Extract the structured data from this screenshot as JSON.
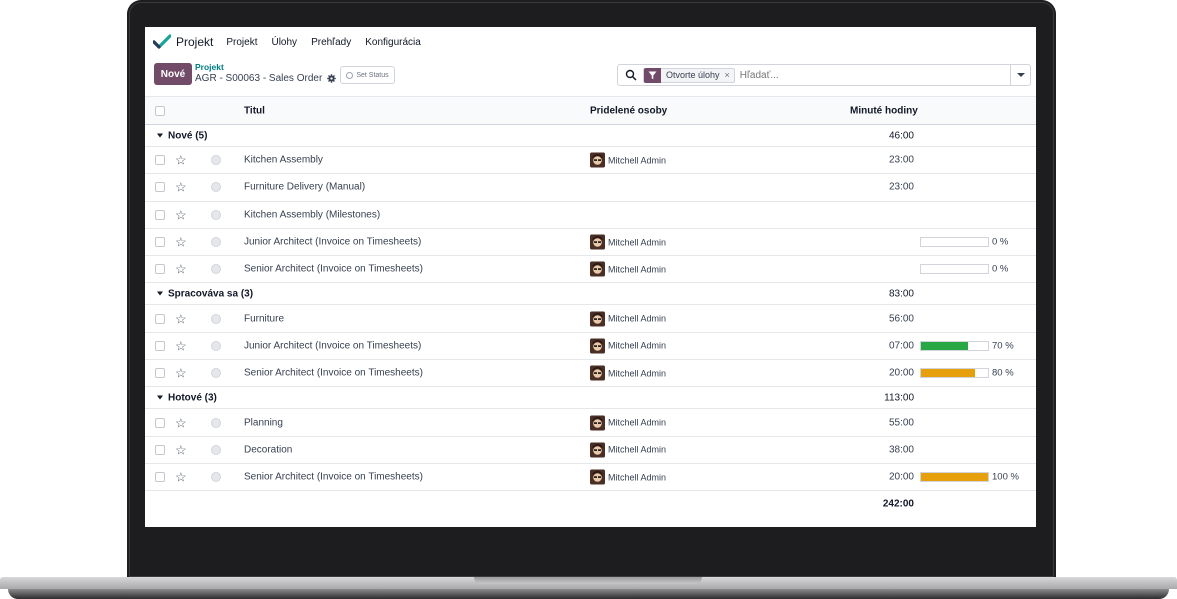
{
  "nav": {
    "app_name": "Projekt",
    "items": [
      "Projekt",
      "Úlohy",
      "Prehľady",
      "Konfigurácia"
    ]
  },
  "control": {
    "new_button": "Nové",
    "breadcrumb_parent": "Projekt",
    "breadcrumb_current": "AGR - S00063 - Sales Order",
    "set_status": "Set Status"
  },
  "search": {
    "facet": "Otvorte úlohy",
    "facet_remove": "×",
    "placeholder": "Hľadať..."
  },
  "columns": {
    "title": "Titul",
    "assignees": "Pridelené osoby",
    "hours": "Minuté hodiny"
  },
  "groups": [
    {
      "label": "Nové (5)",
      "total": "46:00",
      "rows": [
        {
          "title": "Kitchen Assembly",
          "assignee": "Mitchell Admin",
          "hours": "23:00",
          "progress": null,
          "progress_text": ""
        },
        {
          "title": "Furniture Delivery (Manual)",
          "assignee": "",
          "hours": "23:00",
          "progress": null,
          "progress_text": ""
        },
        {
          "title": "Kitchen Assembly (Milestones)",
          "assignee": "",
          "hours": "",
          "progress": null,
          "progress_text": ""
        },
        {
          "title": "Junior Architect (Invoice on Timesheets)",
          "assignee": "Mitchell Admin",
          "hours": "",
          "progress": 0,
          "progress_text": "0 %"
        },
        {
          "title": "Senior Architect (Invoice on Timesheets)",
          "assignee": "Mitchell Admin",
          "hours": "",
          "progress": 0,
          "progress_text": "0 %"
        }
      ]
    },
    {
      "label": "Spracováva sa (3)",
      "total": "83:00",
      "rows": [
        {
          "title": "Furniture",
          "assignee": "Mitchell Admin",
          "hours": "56:00",
          "progress": null,
          "progress_text": ""
        },
        {
          "title": "Junior Architect (Invoice on Timesheets)",
          "assignee": "Mitchell Admin",
          "hours": "07:00",
          "progress": 70,
          "progress_text": "70 %"
        },
        {
          "title": "Senior Architect (Invoice on Timesheets)",
          "assignee": "Mitchell Admin",
          "hours": "20:00",
          "progress": 80,
          "progress_text": "80 %"
        }
      ]
    },
    {
      "label": "Hotové (3)",
      "total": "113:00",
      "rows": [
        {
          "title": "Planning",
          "assignee": "Mitchell Admin",
          "hours": "55:00",
          "progress": null,
          "progress_text": ""
        },
        {
          "title": "Decoration",
          "assignee": "Mitchell Admin",
          "hours": "38:00",
          "progress": null,
          "progress_text": ""
        },
        {
          "title": "Senior Architect (Invoice on Timesheets)",
          "assignee": "Mitchell Admin",
          "hours": "20:00",
          "progress": 100,
          "progress_text": "100 %"
        }
      ]
    }
  ],
  "footer": {
    "total": "242:00"
  },
  "colors": {
    "brand": "#714b67",
    "progress_green": "#28a745",
    "progress_orange": "#e6a00b"
  }
}
